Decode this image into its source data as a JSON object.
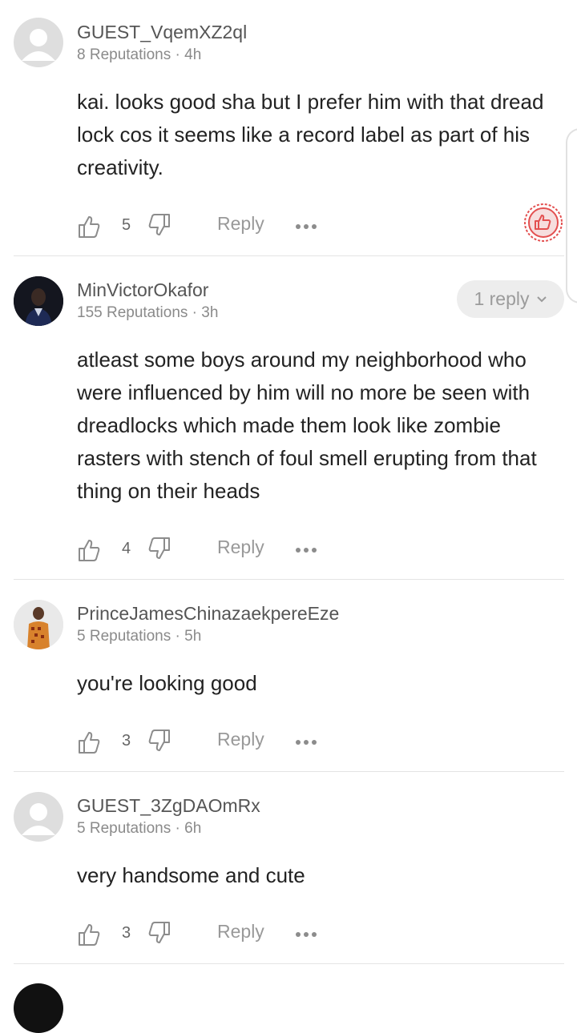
{
  "comments": [
    {
      "username": "GUEST_VqemXZ2ql",
      "reputation": "8 Reputations",
      "time": "4h",
      "text": "kai. looks good sha but I prefer him with that dread lock cos it seems like a record label as part of his creativity.",
      "likes": "5",
      "reply_label": "Reply",
      "avatar": "guest-avatar-icon"
    },
    {
      "username": "MinVictorOkafor",
      "reputation": "155 Reputations",
      "time": "3h",
      "text": "atleast some boys around my neighborhood who were influenced by him will  no more be seen with dreadlocks which made them look like zombie rasters with stench of foul smell erupting from that thing on their heads",
      "likes": "4",
      "reply_label": "Reply",
      "replies_label": "1 reply",
      "avatar": "user-photo"
    },
    {
      "username": "PrinceJamesChinazaekpereEze",
      "reputation": "5 Reputations",
      "time": "5h",
      "text": "you're looking good",
      "likes": "3",
      "reply_label": "Reply",
      "avatar": "user-photo"
    },
    {
      "username": "GUEST_3ZgDAOmRx",
      "reputation": "5 Reputations",
      "time": "6h",
      "text": "very handsome and cute",
      "likes": "3",
      "reply_label": "Reply",
      "avatar": "guest-avatar-icon"
    }
  ],
  "separator": " · ",
  "colors": {
    "badge": "#e35050",
    "icon": "#8c8c8c",
    "pill_bg": "#ededed"
  },
  "icons": [
    "thumbs-up-icon",
    "thumbs-down-icon",
    "more-dots-icon",
    "chevron-down-icon",
    "thumbs-up-badge-icon"
  ]
}
